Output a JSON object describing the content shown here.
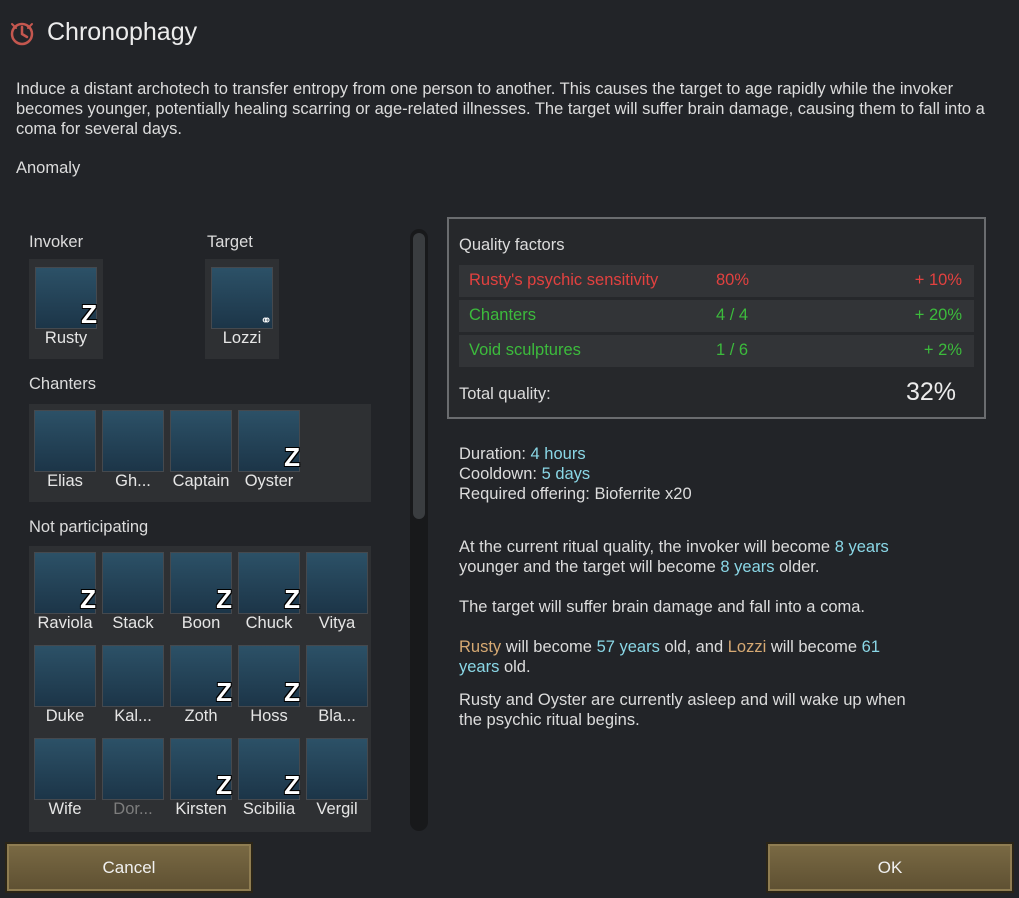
{
  "window": {
    "title": "Chronophagy",
    "title_icon": "ritual-clock-icon",
    "description": "Induce a distant archotech to transfer entropy from one person to another. This causes the target to age rapidly while the invoker becomes younger, potentially healing scarring or age-related illnesses. The target will suffer brain damage, causing them to fall into a coma for several days.",
    "category": "Anomaly"
  },
  "roles": {
    "invoker_label": "Invoker",
    "target_label": "Target",
    "invoker": {
      "name": "Rusty",
      "asleep": true
    },
    "target": {
      "name": "Lozzi",
      "prisoner": true
    },
    "chanters_label": "Chanters",
    "chanters": [
      {
        "name": "Elias",
        "asleep": false
      },
      {
        "name": "Gh...",
        "asleep": false
      },
      {
        "name": "Captain",
        "asleep": false
      },
      {
        "name": "Oyster",
        "asleep": true
      }
    ],
    "not_participating_label": "Not participating",
    "not_participating": [
      {
        "name": "Raviola",
        "asleep": true
      },
      {
        "name": "Stack",
        "asleep": false
      },
      {
        "name": "Boon",
        "asleep": true
      },
      {
        "name": "Chuck",
        "asleep": true
      },
      {
        "name": "Vitya",
        "asleep": false
      },
      {
        "name": "Duke",
        "asleep": false
      },
      {
        "name": "Kal...",
        "asleep": false
      },
      {
        "name": "Zoth",
        "asleep": true
      },
      {
        "name": "Hoss",
        "asleep": true
      },
      {
        "name": "Bla...",
        "asleep": false
      },
      {
        "name": "Wife",
        "asleep": false
      },
      {
        "name": "Dor...",
        "asleep": false,
        "dim": true
      },
      {
        "name": "Kirsten",
        "asleep": true
      },
      {
        "name": "Scibilia",
        "asleep": true
      },
      {
        "name": "Vergil",
        "asleep": false
      }
    ]
  },
  "quality": {
    "title": "Quality factors",
    "factors": [
      {
        "label": "Rusty's psychic sensitivity",
        "value": "80%",
        "bonus": "+ 10%",
        "color": "#e2413f"
      },
      {
        "label": "Chanters",
        "value": "4 / 4",
        "bonus": "+ 20%",
        "color": "#3cbb3c"
      },
      {
        "label": "Void sculptures",
        "value": "1 / 6",
        "bonus": "+ 2%",
        "color": "#3cbb3c"
      }
    ],
    "total_label": "Total quality:",
    "total_value": "32%"
  },
  "info": {
    "duration_label": "Duration: ",
    "duration_value": "4 hours",
    "cooldown_label": "Cooldown: ",
    "cooldown_value": "5 days",
    "offering": "Required offering: Bioferrite x20",
    "p1_a": "At the current ritual quality, the invoker will become ",
    "p1_b": "8 years",
    "p1_c": "younger and the target will become ",
    "p1_d": "8 years",
    "p1_e": " older.",
    "p2": "The target will suffer brain damage and fall into a coma.",
    "p3_a": "Rusty",
    "p3_b": " will become ",
    "p3_c": "57 years",
    "p3_d": " old, and ",
    "p3_e": "Lozzi",
    "p3_f": " will become ",
    "p3_g": "61",
    "p3_h": "years",
    "p3_i": " old.",
    "p4_line1": "Rusty and Oyster are currently asleep and will wake up when",
    "p4_line2": "the psychic ritual begins."
  },
  "buttons": {
    "cancel": "Cancel",
    "ok": "OK"
  }
}
